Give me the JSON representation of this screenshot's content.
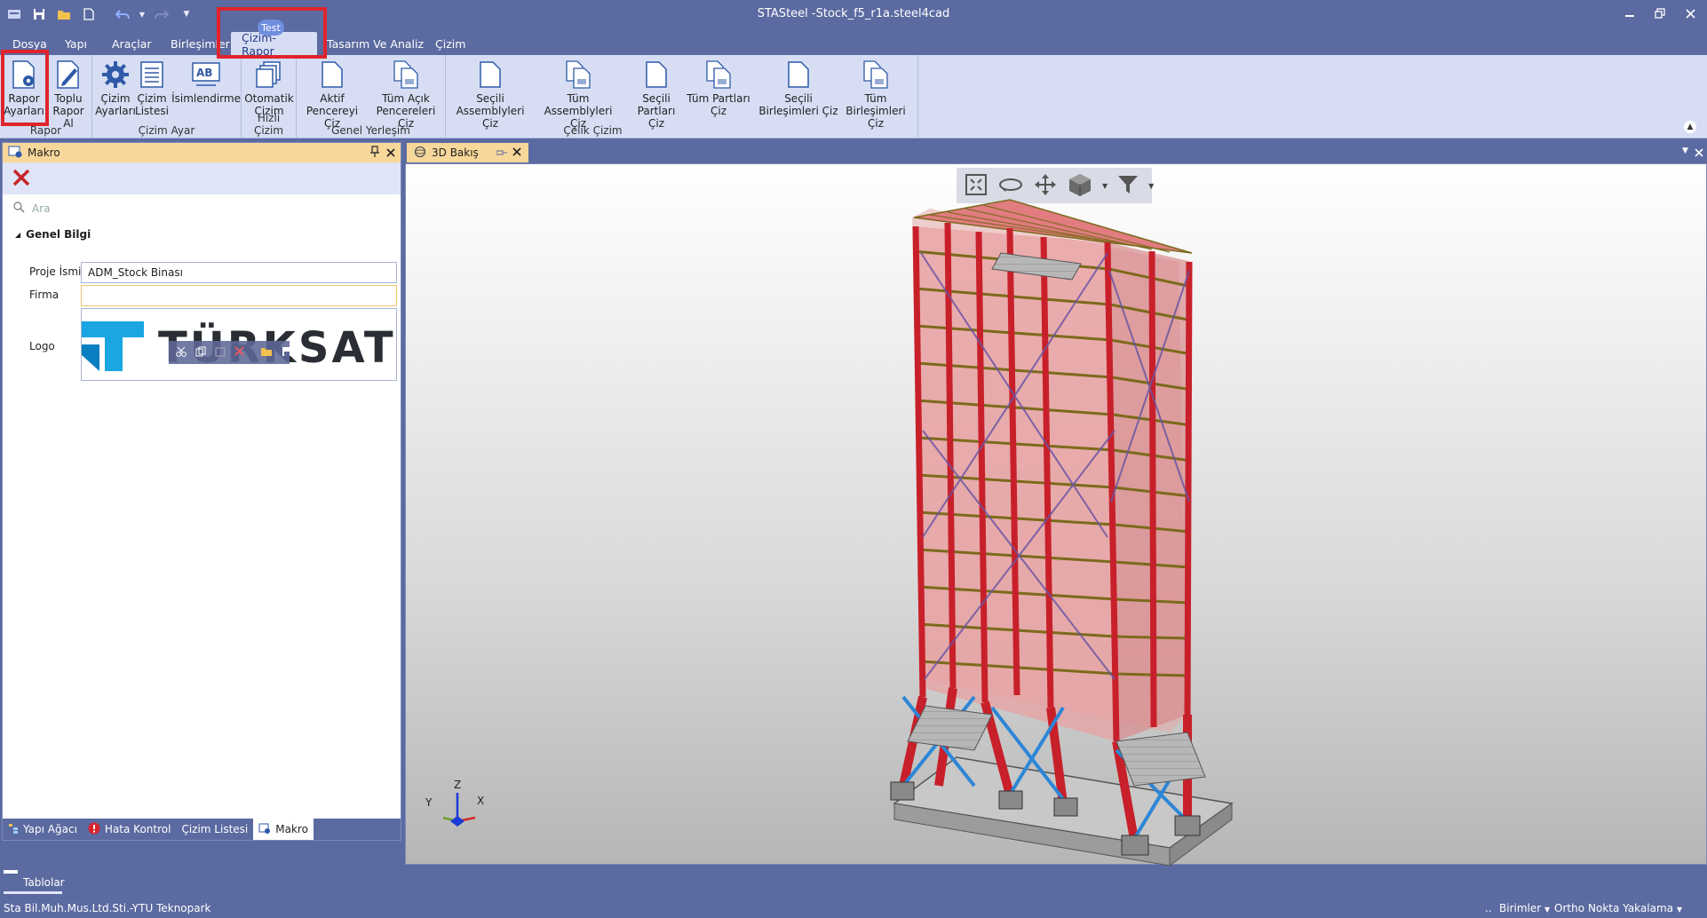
{
  "window": {
    "title": "STASteel -Stock_f5_r1a.steel4cad"
  },
  "quick_access": [
    "app-menu-icon",
    "save-icon",
    "open-folder-icon",
    "new-file-icon",
    "undo-icon",
    "redo-icon",
    "customize-icon"
  ],
  "menu_tabs": [
    {
      "label": "Dosya"
    },
    {
      "label": "Yapı"
    },
    {
      "label": "Araçlar"
    },
    {
      "label": "Birleşimler"
    },
    {
      "label": "Çizim-Rapor",
      "active": true
    },
    {
      "label": "Tasarım Ve Analiz"
    },
    {
      "label": "Çizim"
    }
  ],
  "context_badge": "Test",
  "ribbon": {
    "groups": [
      {
        "label": "Rapor",
        "buttons": [
          {
            "label_l1": "Rapor",
            "label_l2": "Ayarları",
            "icon": "report-settings-icon"
          },
          {
            "label_l1": "Toplu",
            "label_l2": "Rapor Al",
            "icon": "bulk-report-icon"
          }
        ]
      },
      {
        "label": "Çizim Ayar",
        "buttons": [
          {
            "label_l1": "Çizim",
            "label_l2": "Ayarları",
            "icon": "gear-icon"
          },
          {
            "label_l1": "Çizim",
            "label_l2": "Listesi",
            "icon": "list-icon"
          },
          {
            "label_l1": "İsimlendirme",
            "label_l2": "",
            "icon": "naming-icon"
          }
        ]
      },
      {
        "label": "Hızlı Çizim",
        "buttons": [
          {
            "label_l1": "Otomatik",
            "label_l2": "Çizim",
            "icon": "auto-draw-icon"
          }
        ]
      },
      {
        "label": "Genel Yerleşim",
        "buttons": [
          {
            "label_l1": "Aktif",
            "label_l2": "Pencereyi Çiz",
            "icon": "page-icon"
          },
          {
            "label_l1": "Tüm Açık",
            "label_l2": "Pencereleri Çiz",
            "icon": "pages-icon"
          }
        ]
      },
      {
        "label": "Çelik Çizim",
        "buttons": [
          {
            "label_l1": "Seçili",
            "label_l2": "Assemblyleri Çiz",
            "icon": "page-icon"
          },
          {
            "label_l1": "Tüm Assemblyleri",
            "label_l2": "Çiz",
            "icon": "pages-icon"
          },
          {
            "label_l1": "Seçili",
            "label_l2": "Partları Çiz",
            "icon": "page-icon"
          },
          {
            "label_l1": "Tüm Partları",
            "label_l2": "Çiz",
            "icon": "pages-icon"
          }
        ]
      },
      {
        "label": "",
        "buttons": [
          {
            "label_l1": "Seçili",
            "label_l2": "Birleşimleri Çiz",
            "icon": "page-icon"
          },
          {
            "label_l1": "Tüm Birleşimleri",
            "label_l2": "Çiz",
            "icon": "pages-icon"
          }
        ]
      }
    ]
  },
  "left_panel": {
    "title": "Makro",
    "search_placeholder": "Ara",
    "section_title": "Genel Bilgi",
    "fields": {
      "project_name_label": "Proje İsmi",
      "project_name_value": "ADM_Stock Binası",
      "company_label": "Firma",
      "company_value": "",
      "logo_label": "Logo",
      "logo_text": "TÜRKSAT"
    },
    "bottom_tabs": [
      {
        "label": "Yapı Ağacı"
      },
      {
        "label": "Hata Kontrol"
      },
      {
        "label": "Çizim Listesi"
      },
      {
        "label": "Makro",
        "active": true
      }
    ]
  },
  "document": {
    "tab_label": "3D Bakış",
    "axis": {
      "z": "Z",
      "y": "Y",
      "x": "X"
    }
  },
  "tables_tab": "Tablolar",
  "status": {
    "company": "Sta Bil.Muh.Mus.Ltd.Sti.-YTU Teknopark",
    "dots": "..",
    "units": "Birimler",
    "ortho": "Ortho",
    "snap": "Nokta Yakalama"
  },
  "colors": {
    "chrome": "#5b6aa0",
    "ribbon": "#d7def4",
    "panel_header": "#f7d79a",
    "highlight": "#e0242c",
    "structure_red": "#c8202a",
    "bracing_blue": "#2d86d6",
    "beam_olive": "#7c6a1c"
  }
}
